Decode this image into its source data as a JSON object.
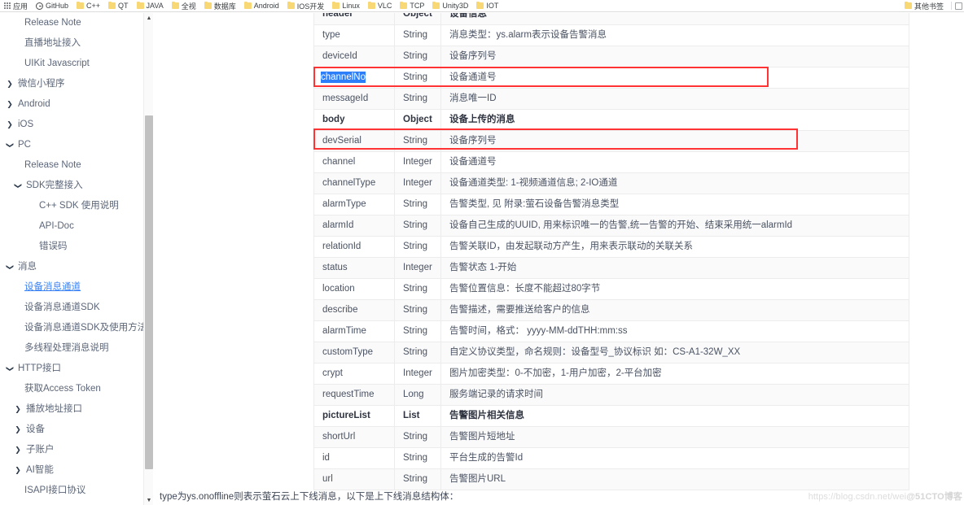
{
  "bookmarks": {
    "apps_label": "应用",
    "items": [
      {
        "label": "GitHub",
        "icon": "github-icon"
      },
      {
        "label": "C++",
        "icon": "folder-icon"
      },
      {
        "label": "QT",
        "icon": "folder-icon"
      },
      {
        "label": "JAVA",
        "icon": "folder-icon"
      },
      {
        "label": "全视",
        "icon": "folder-icon"
      },
      {
        "label": "数据库",
        "icon": "folder-icon"
      },
      {
        "label": "Android",
        "icon": "folder-icon"
      },
      {
        "label": "IOS开发",
        "icon": "folder-icon"
      },
      {
        "label": "Linux",
        "icon": "folder-icon"
      },
      {
        "label": "VLC",
        "icon": "folder-icon"
      },
      {
        "label": "TCP",
        "icon": "folder-icon"
      },
      {
        "label": "Unity3D",
        "icon": "folder-icon"
      },
      {
        "label": "IOT",
        "icon": "folder-icon"
      }
    ],
    "other_label": "其他书签"
  },
  "sidebar": {
    "items": [
      {
        "label": "Release Note",
        "level": 3,
        "caret": "",
        "active": false
      },
      {
        "label": "直播地址接入",
        "level": 3,
        "caret": "",
        "active": false
      },
      {
        "label": "UIKit Javascript",
        "level": 3,
        "caret": "",
        "active": false
      },
      {
        "label": "微信小程序",
        "level": 1,
        "caret": "right",
        "active": false
      },
      {
        "label": "Android",
        "level": 1,
        "caret": "right",
        "active": false
      },
      {
        "label": "iOS",
        "level": 1,
        "caret": "right",
        "active": false
      },
      {
        "label": "PC",
        "level": 1,
        "caret": "down",
        "active": false
      },
      {
        "label": "Release Note",
        "level": 3,
        "caret": "",
        "active": false
      },
      {
        "label": "SDK完整接入",
        "level": 2,
        "caret": "down",
        "active": false
      },
      {
        "label": "C++ SDK 使用说明",
        "level": 4,
        "caret": "",
        "active": false
      },
      {
        "label": "API-Doc",
        "level": 4,
        "caret": "",
        "active": false
      },
      {
        "label": "错误码",
        "level": 4,
        "caret": "",
        "active": false
      },
      {
        "label": "消息",
        "level": 1,
        "caret": "down",
        "active": false
      },
      {
        "label": "设备消息通道",
        "level": 3,
        "caret": "",
        "active": true
      },
      {
        "label": "设备消息通道SDK",
        "level": 3,
        "caret": "",
        "active": false
      },
      {
        "label": "设备消息通道SDK及使用方法",
        "level": 3,
        "caret": "",
        "active": false
      },
      {
        "label": "多线程处理消息说明",
        "level": 3,
        "caret": "",
        "active": false
      },
      {
        "label": "HTTP接口",
        "level": 1,
        "caret": "down",
        "active": false
      },
      {
        "label": "获取Access Token",
        "level": 3,
        "caret": "",
        "active": false
      },
      {
        "label": "播放地址接口",
        "level": 2,
        "caret": "right",
        "active": false
      },
      {
        "label": "设备",
        "level": 2,
        "caret": "right",
        "active": false
      },
      {
        "label": "子账户",
        "level": 2,
        "caret": "right",
        "active": false
      },
      {
        "label": "AI智能",
        "level": 2,
        "caret": "right",
        "active": false
      },
      {
        "label": "ISAPI接口协议",
        "level": 3,
        "caret": "",
        "active": false
      }
    ]
  },
  "table": {
    "rows": [
      {
        "field": "header",
        "type": "Object",
        "desc": "设备信息",
        "bold": true,
        "alt": true,
        "selected": false,
        "highlight": null
      },
      {
        "field": "type",
        "type": "String",
        "desc": "消息类型：ys.alarm表示设备告警消息",
        "bold": false,
        "alt": false,
        "selected": false,
        "highlight": null
      },
      {
        "field": "deviceId",
        "type": "String",
        "desc": "设备序列号",
        "bold": false,
        "alt": true,
        "selected": false,
        "highlight": null
      },
      {
        "field": "channelNo",
        "type": "String",
        "desc": "设备通道号",
        "bold": false,
        "alt": false,
        "selected": true,
        "highlight": "box1"
      },
      {
        "field": "messageId",
        "type": "String",
        "desc": "消息唯一ID",
        "bold": false,
        "alt": true,
        "selected": false,
        "highlight": null
      },
      {
        "field": "body",
        "type": "Object",
        "desc": "设备上传的消息",
        "bold": true,
        "alt": false,
        "selected": false,
        "highlight": null
      },
      {
        "field": "devSerial",
        "type": "String",
        "desc": "设备序列号",
        "bold": false,
        "alt": true,
        "selected": false,
        "highlight": "box2"
      },
      {
        "field": "channel",
        "type": "Integer",
        "desc": "设备通道号",
        "bold": false,
        "alt": false,
        "selected": false,
        "highlight": null
      },
      {
        "field": "channelType",
        "type": "Integer",
        "desc": "设备通道类型: 1-视频通道信息; 2-IO通道",
        "bold": false,
        "alt": true,
        "selected": false,
        "highlight": null
      },
      {
        "field": "alarmType",
        "type": "String",
        "desc": "告警类型, 见 附录:萤石设备告警消息类型",
        "bold": false,
        "alt": false,
        "selected": false,
        "highlight": null
      },
      {
        "field": "alarmId",
        "type": "String",
        "desc": "设备自己生成的UUID, 用来标识唯一的告警,统一告警的开始、结束采用统一alarmId",
        "bold": false,
        "alt": true,
        "selected": false,
        "highlight": null
      },
      {
        "field": "relationId",
        "type": "String",
        "desc": "告警关联ID，由发起联动方产生，用来表示联动的关联关系",
        "bold": false,
        "alt": false,
        "selected": false,
        "highlight": null
      },
      {
        "field": "status",
        "type": "Integer",
        "desc": "告警状态 1-开始",
        "bold": false,
        "alt": true,
        "selected": false,
        "highlight": null
      },
      {
        "field": "location",
        "type": "String",
        "desc": "告警位置信息：长度不能超过80字节",
        "bold": false,
        "alt": false,
        "selected": false,
        "highlight": null
      },
      {
        "field": "describe",
        "type": "String",
        "desc": "告警描述，需要推送给客户的信息",
        "bold": false,
        "alt": true,
        "selected": false,
        "highlight": null
      },
      {
        "field": "alarmTime",
        "type": "String",
        "desc": "告警时间，格式： yyyy-MM-ddTHH:mm:ss",
        "bold": false,
        "alt": false,
        "selected": false,
        "highlight": null
      },
      {
        "field": "customType",
        "type": "String",
        "desc": "自定义协议类型，命名规则：设备型号_协议标识 如：CS-A1-32W_XX",
        "bold": false,
        "alt": true,
        "selected": false,
        "highlight": null
      },
      {
        "field": "crypt",
        "type": "Integer",
        "desc": "图片加密类型：0-不加密，1-用户加密，2-平台加密",
        "bold": false,
        "alt": false,
        "selected": false,
        "highlight": null
      },
      {
        "field": "requestTime",
        "type": "Long",
        "desc": "服务端记录的请求时间",
        "bold": false,
        "alt": true,
        "selected": false,
        "highlight": null
      },
      {
        "field": "pictureList",
        "type": "List",
        "desc": "告警图片相关信息",
        "bold": true,
        "alt": false,
        "selected": false,
        "highlight": null
      },
      {
        "field": "shortUrl",
        "type": "String",
        "desc": "告警图片短地址",
        "bold": false,
        "alt": true,
        "selected": false,
        "highlight": null
      },
      {
        "field": "id",
        "type": "String",
        "desc": "平台生成的告警Id",
        "bold": false,
        "alt": false,
        "selected": false,
        "highlight": null
      },
      {
        "field": "url",
        "type": "String",
        "desc": "告警图片URL",
        "bold": false,
        "alt": true,
        "selected": false,
        "highlight": null
      }
    ]
  },
  "footnote": "type为ys.onoffline则表示萤石云上下线消息，以下是上下线消息结构体：",
  "watermark": {
    "url": "https://blog.csdn.net/wei",
    "tag": "@51CTO博客"
  },
  "colors": {
    "accent": "#3b82f6",
    "highlight_box": "#ff3333",
    "selection": "#2d7ff9",
    "folder": "#f8d775"
  }
}
